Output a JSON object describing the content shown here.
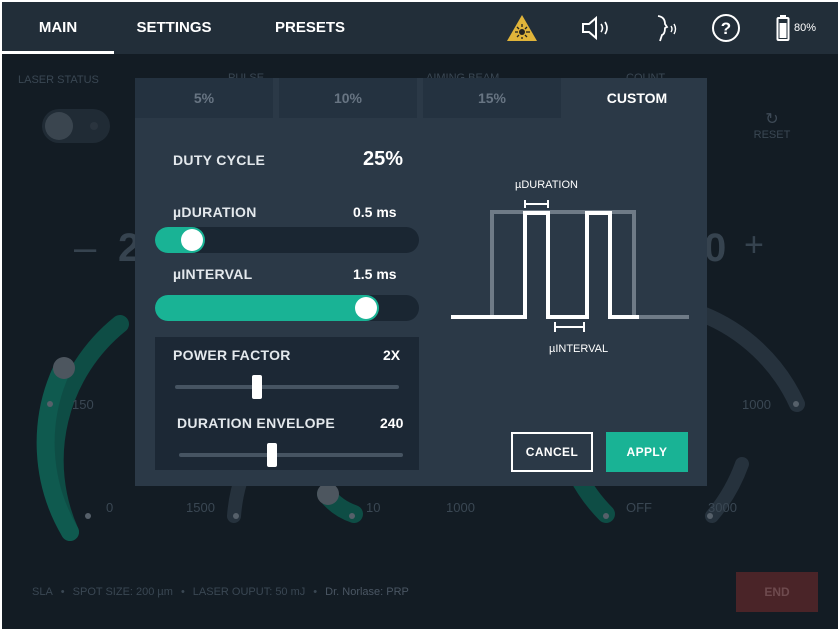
{
  "topbar": {
    "tabs": [
      {
        "label": "MAIN",
        "active": true
      },
      {
        "label": "SETTINGS",
        "active": false
      },
      {
        "label": "PRESETS",
        "active": false
      }
    ],
    "icons": [
      "laser-warning-icon",
      "speaker-icon",
      "voice-icon",
      "help-icon",
      "battery-icon"
    ],
    "battery_label": "80%",
    "accent_color": "#19b395",
    "warning_color": "#e0b43a"
  },
  "background": {
    "laser_status_label": "LASER STATUS",
    "pulse_label": "PULSE",
    "aiming_beam_label": "AIMING BEAM",
    "count_label": "COUNT",
    "reset_label": "RESET",
    "minus": "–",
    "plus": "+",
    "left_digit": "2",
    "right_digit": "0",
    "gauge_left": {
      "label_150": "150",
      "label_0": "0"
    },
    "gauge_mid": {
      "label_1500": "1500",
      "label_10": "10",
      "label_1000": "1000"
    },
    "gauge_right": {
      "label_off": "OFF",
      "label_3000": "3000",
      "label_1000": "1000"
    },
    "footer": {
      "sla": "SLA",
      "spot_size": "SPOT SIZE: 200 µm",
      "laser_output": "LASER OUPUT: 50 mJ",
      "doctor": "Dr. Norlase: PRP",
      "end_label": "END"
    }
  },
  "modal": {
    "tabs": [
      {
        "label": "5%",
        "active": false
      },
      {
        "label": "10%",
        "active": false
      },
      {
        "label": "15%",
        "active": false
      },
      {
        "label": "CUSTOM",
        "active": true
      }
    ],
    "duty_cycle": {
      "label": "DUTY CYCLE",
      "value": "25%"
    },
    "micro_duration": {
      "label": "µDURATION",
      "value": "0.5 ms",
      "fraction": 0.1
    },
    "micro_interval": {
      "label": "µINTERVAL",
      "value": "1.5 ms",
      "fraction": 0.83
    },
    "power_factor": {
      "label": "POWER FACTOR",
      "value": "2X",
      "fraction": 0.36
    },
    "duration_envelope": {
      "label": "DURATION ENVELOPE",
      "value": "240",
      "fraction": 0.41
    },
    "diagram": {
      "duration_label": "µDURATION",
      "interval_label": "µINTERVAL"
    },
    "cancel_label": "CANCEL",
    "apply_label": "APPLY"
  }
}
